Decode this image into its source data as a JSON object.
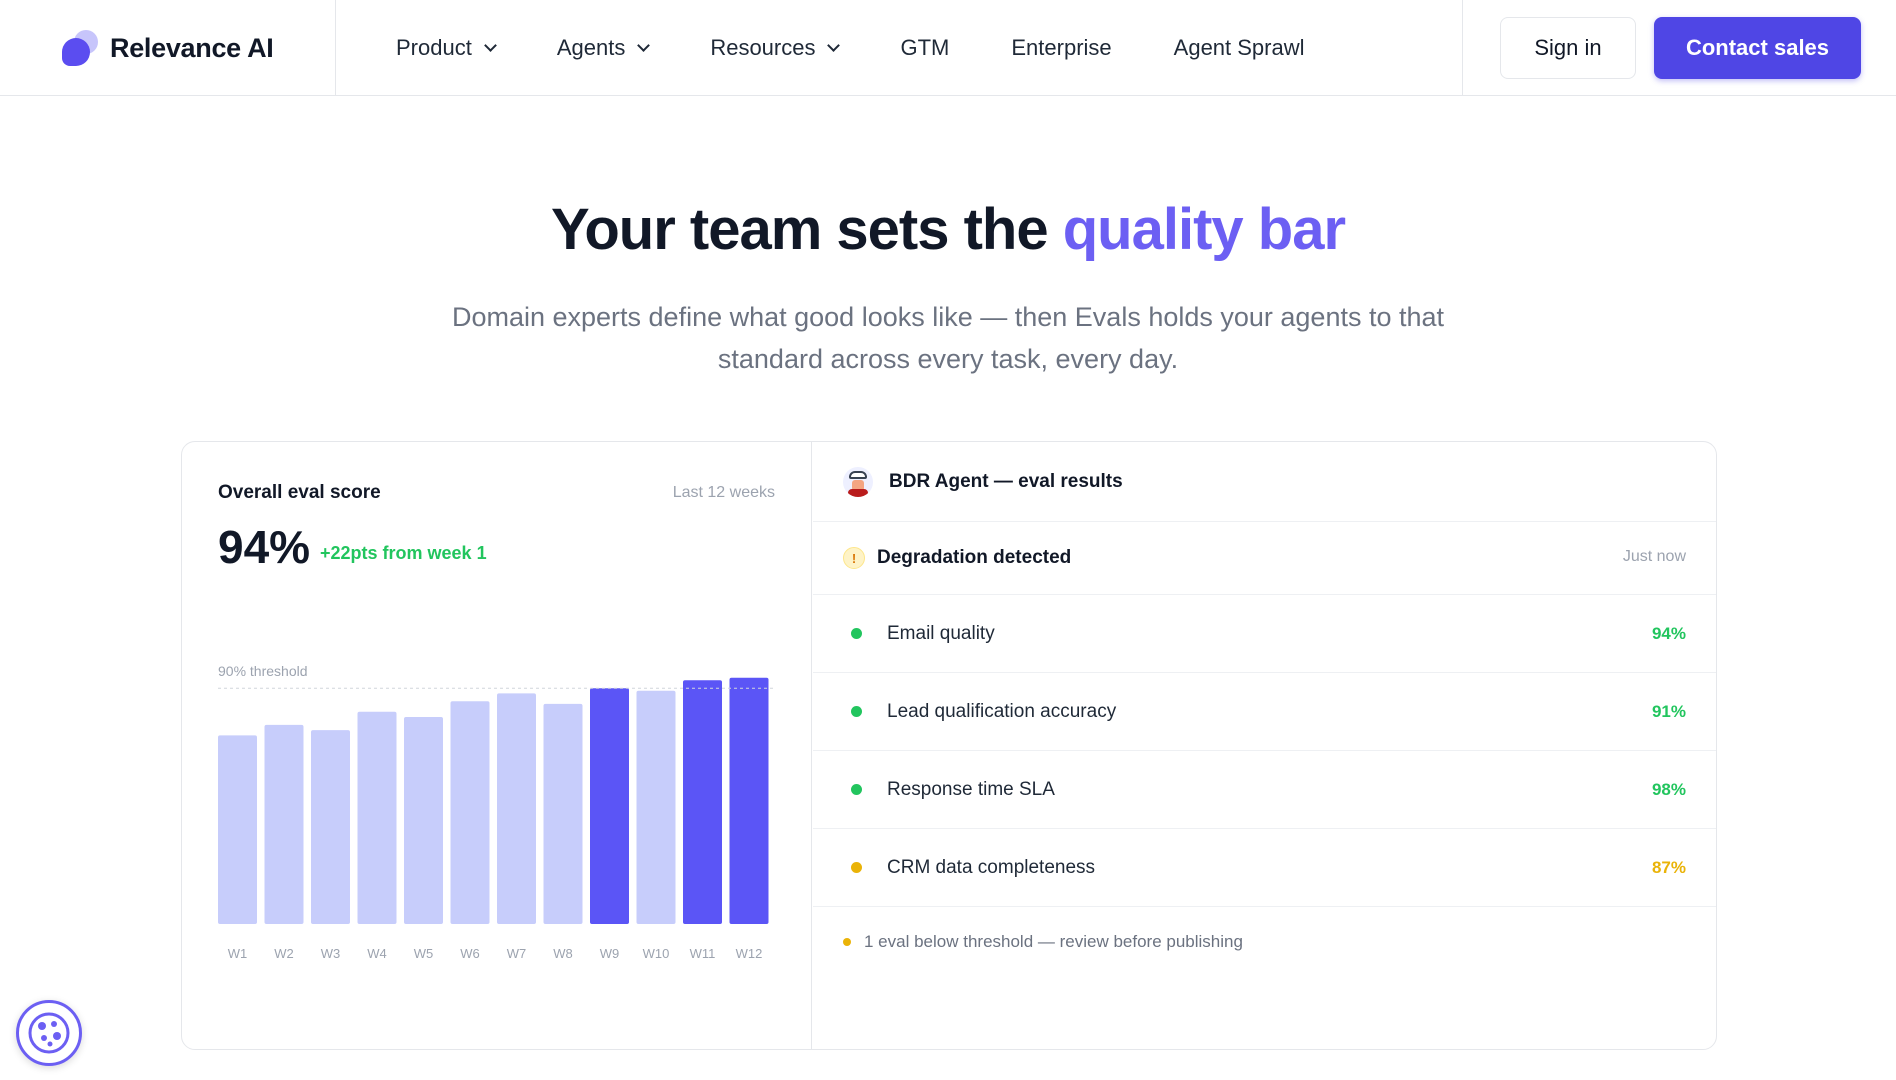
{
  "nav": {
    "brand": "Relevance AI",
    "items": [
      {
        "label": "Product",
        "dropdown": true
      },
      {
        "label": "Agents",
        "dropdown": true
      },
      {
        "label": "Resources",
        "dropdown": true
      },
      {
        "label": "GTM",
        "dropdown": false
      },
      {
        "label": "Enterprise",
        "dropdown": false
      },
      {
        "label": "Agent Sprawl",
        "dropdown": false
      }
    ],
    "sign_in": "Sign in",
    "contact_sales": "Contact sales"
  },
  "hero": {
    "title_main": "Your team sets the ",
    "title_accent": "quality bar",
    "subtitle": "Domain experts define what good looks like — then Evals holds your agents to that standard across every task, every day."
  },
  "score_panel": {
    "title": "Overall eval score",
    "period": "Last 12 weeks",
    "score": "94%",
    "delta": "+22pts from week 1",
    "threshold_label": "90% threshold"
  },
  "chart_data": {
    "type": "bar",
    "categories": [
      "W1",
      "W2",
      "W3",
      "W4",
      "W5",
      "W6",
      "W7",
      "W8",
      "W9",
      "W10",
      "W11",
      "W12"
    ],
    "values": [
      72,
      76,
      74,
      81,
      79,
      85,
      88,
      84,
      90,
      89,
      93,
      94
    ],
    "highlighted": [
      false,
      false,
      false,
      false,
      false,
      false,
      false,
      false,
      true,
      false,
      true,
      true
    ],
    "threshold": 90,
    "ylim": [
      0,
      100
    ],
    "colors": {
      "normal": "#c7cdfb",
      "highlight": "#5b55f6",
      "threshold_line": "#d1d5db"
    }
  },
  "results_panel": {
    "title": "BDR Agent — eval results",
    "alert": {
      "title": "Degradation detected",
      "time": "Just now",
      "icon": "warning-icon"
    },
    "metrics": [
      {
        "label": "Email quality",
        "value": "94%",
        "status": "pass",
        "color": "#22c55e"
      },
      {
        "label": "Lead qualification accuracy",
        "value": "91%",
        "status": "pass",
        "color": "#22c55e"
      },
      {
        "label": "Response time SLA",
        "value": "98%",
        "status": "pass",
        "color": "#22c55e"
      },
      {
        "label": "CRM data completeness",
        "value": "87%",
        "status": "warn",
        "color": "#eab308"
      }
    ],
    "footnote": "1 eval below threshold — review before publishing"
  },
  "colors": {
    "accent": "#6c5ff3",
    "brand": "#4f46e5",
    "pass": "#22c55e",
    "warn": "#eab308"
  }
}
